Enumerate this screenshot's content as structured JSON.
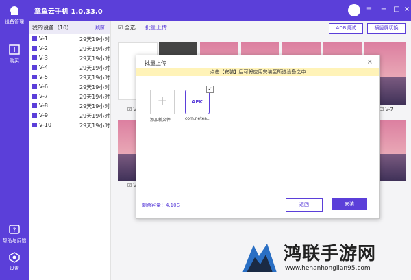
{
  "app": {
    "title": "章鱼云手机 1.0.33.0"
  },
  "rail": {
    "device_mgmt": "设备管理",
    "purchase": "购买",
    "help": "帮助与反馈",
    "settings": "设置"
  },
  "devices": {
    "header": "我的设备（10）",
    "refresh": "刷新",
    "items": [
      {
        "name": "V-1",
        "time": "29天19小时"
      },
      {
        "name": "V-2",
        "time": "29天19小时"
      },
      {
        "name": "V-3",
        "time": "29天19小时"
      },
      {
        "name": "V-4",
        "time": "29天19小时"
      },
      {
        "name": "V-5",
        "time": "29天19小时"
      },
      {
        "name": "V-6",
        "time": "29天19小时"
      },
      {
        "name": "V-7",
        "time": "29天19小时"
      },
      {
        "name": "V-8",
        "time": "29天19小时"
      },
      {
        "name": "V-9",
        "time": "29天19小时"
      },
      {
        "name": "V-10",
        "time": "29天19小时"
      }
    ]
  },
  "toolbar": {
    "select_all": "全选",
    "batch_upload": "批量上传",
    "adb": "ADB调试",
    "switch_view": "横竖屏切换"
  },
  "tiles": {
    "label_v": "V",
    "label_v7": "V-7"
  },
  "modal": {
    "title": "批量上传",
    "close": "×",
    "banner": "点击【安装】后可将应用安装至所选设备之中",
    "add_file": "添加新文件",
    "apk_badge": "APK",
    "apk_name": "com.netea...",
    "storage": "剩余容量：4.10G",
    "back": "返回",
    "install": "安装"
  },
  "watermark": {
    "title": "鸿联手游网",
    "url": "www.henanhonglian95.com"
  },
  "colors": {
    "accent": "#5b3fd9"
  }
}
